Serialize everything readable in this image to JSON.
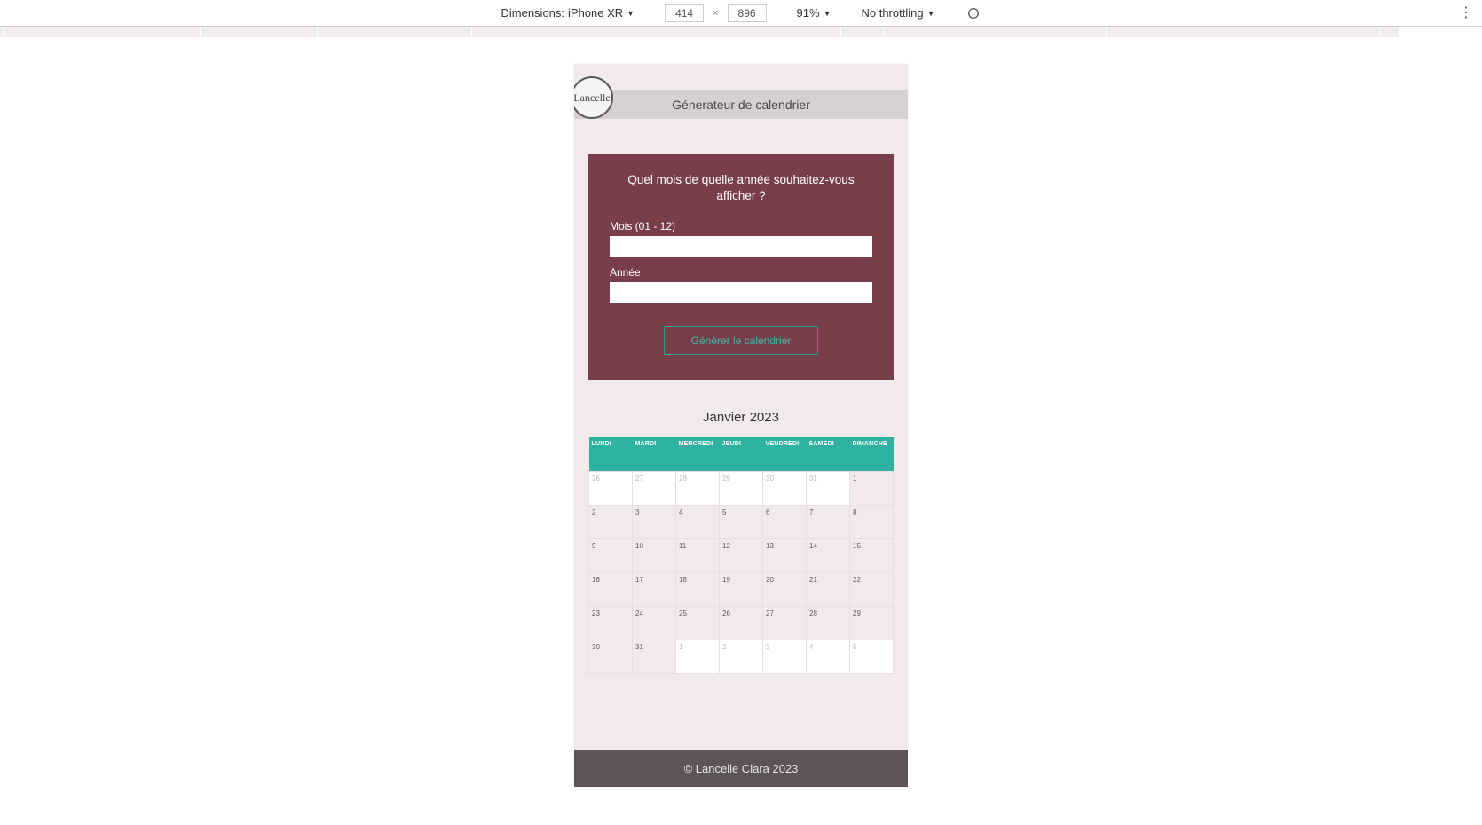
{
  "devtools": {
    "dimensions_label": "Dimensions:",
    "device_name": "iPhone XR",
    "width": "414",
    "height": "896",
    "zoom": "91%",
    "throttling": "No throttling",
    "ruler_segments": [
      6,
      220,
      132,
      174,
      50,
      54,
      312,
      49,
      172,
      78,
      308,
      22
    ]
  },
  "header": {
    "title": "Génerateur de calendrier",
    "logo_text": "Lancelle"
  },
  "form": {
    "question": "Quel mois de quelle année souhaitez-vous afficher ?",
    "month_label": "Mois (01 - 12)",
    "year_label": "Année",
    "month_value": "",
    "year_value": "",
    "submit_label": "Générer le calendrier"
  },
  "calendar": {
    "title": "Janvier 2023",
    "day_headers": [
      "LUNDI",
      "MARDI",
      "MERCREDI",
      "JEUDI",
      "VENDREDI",
      "SAMEDI",
      "DIMANCHE"
    ],
    "weeks": [
      [
        {
          "n": "26",
          "out": true
        },
        {
          "n": "27",
          "out": true
        },
        {
          "n": "28",
          "out": true
        },
        {
          "n": "29",
          "out": true
        },
        {
          "n": "30",
          "out": true
        },
        {
          "n": "31",
          "out": true
        },
        {
          "n": "1",
          "out": false
        }
      ],
      [
        {
          "n": "2",
          "out": false
        },
        {
          "n": "3",
          "out": false
        },
        {
          "n": "4",
          "out": false
        },
        {
          "n": "5",
          "out": false
        },
        {
          "n": "6",
          "out": false
        },
        {
          "n": "7",
          "out": false
        },
        {
          "n": "8",
          "out": false
        }
      ],
      [
        {
          "n": "9",
          "out": false
        },
        {
          "n": "10",
          "out": false
        },
        {
          "n": "11",
          "out": false
        },
        {
          "n": "12",
          "out": false
        },
        {
          "n": "13",
          "out": false
        },
        {
          "n": "14",
          "out": false
        },
        {
          "n": "15",
          "out": false
        }
      ],
      [
        {
          "n": "16",
          "out": false
        },
        {
          "n": "17",
          "out": false
        },
        {
          "n": "18",
          "out": false
        },
        {
          "n": "19",
          "out": false
        },
        {
          "n": "20",
          "out": false
        },
        {
          "n": "21",
          "out": false
        },
        {
          "n": "22",
          "out": false
        }
      ],
      [
        {
          "n": "23",
          "out": false
        },
        {
          "n": "24",
          "out": false
        },
        {
          "n": "25",
          "out": false
        },
        {
          "n": "26",
          "out": false
        },
        {
          "n": "27",
          "out": false
        },
        {
          "n": "28",
          "out": false
        },
        {
          "n": "29",
          "out": false
        }
      ],
      [
        {
          "n": "30",
          "out": false
        },
        {
          "n": "31",
          "out": false
        },
        {
          "n": "1",
          "out": true
        },
        {
          "n": "2",
          "out": true
        },
        {
          "n": "3",
          "out": true
        },
        {
          "n": "4",
          "out": true
        },
        {
          "n": "5",
          "out": true
        }
      ]
    ]
  },
  "footer": {
    "text": "© Lancelle Clara 2023"
  }
}
